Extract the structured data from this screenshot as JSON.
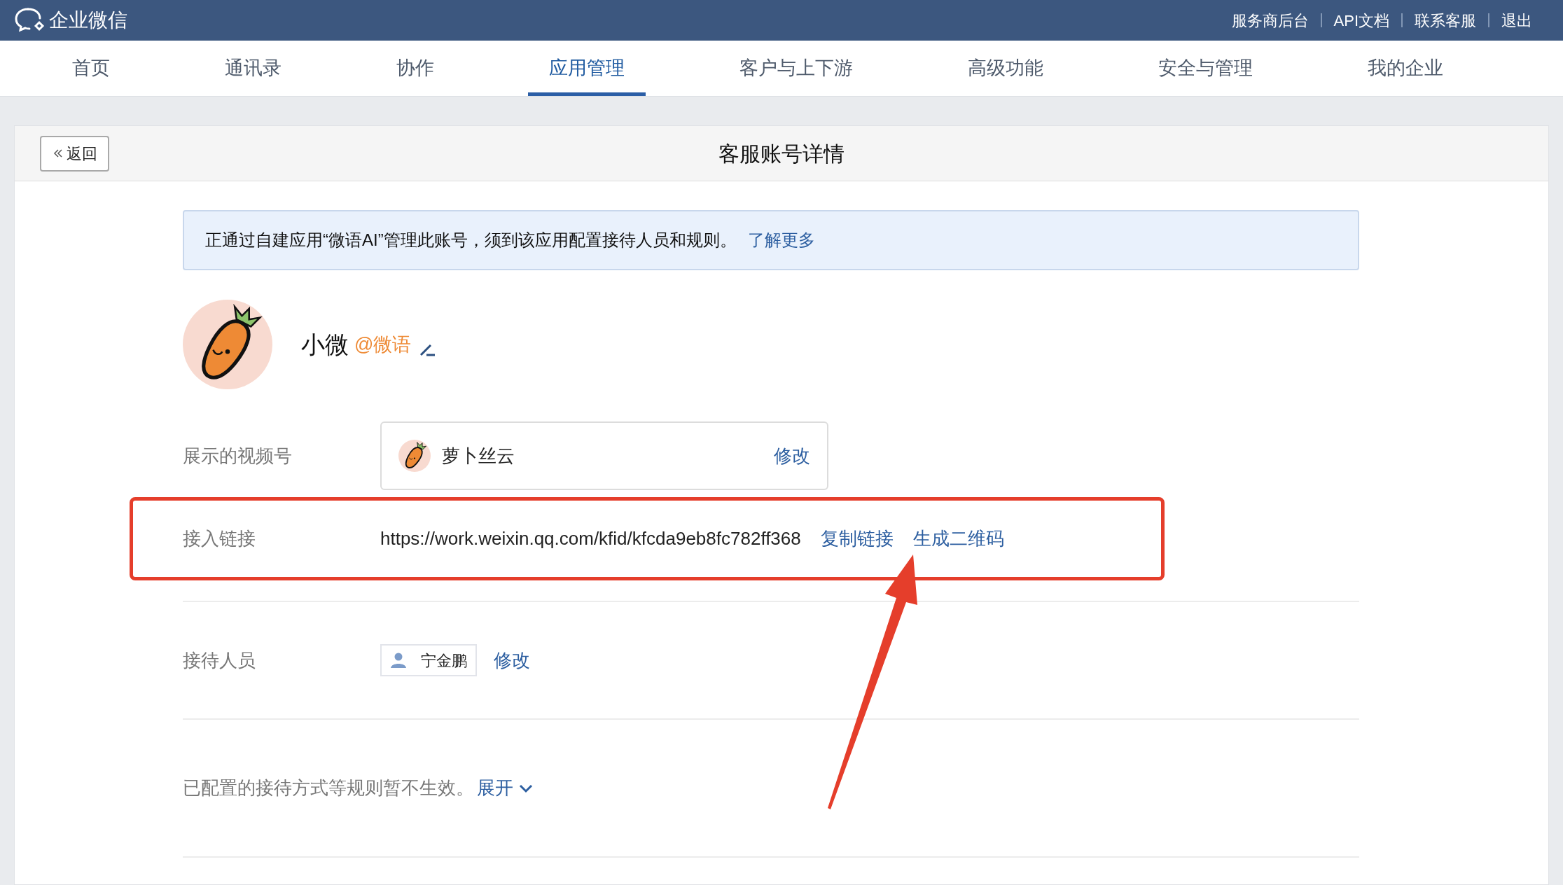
{
  "header": {
    "logo_text": "企业微信",
    "links": [
      "服务商后台",
      "API文档",
      "联系客服",
      "退出"
    ]
  },
  "nav_tabs": [
    {
      "label": "首页",
      "selected": false
    },
    {
      "label": "通讯录",
      "selected": false
    },
    {
      "label": "协作",
      "selected": false
    },
    {
      "label": "应用管理",
      "selected": true
    },
    {
      "label": "客户与上下游",
      "selected": false
    },
    {
      "label": "高级功能",
      "selected": false
    },
    {
      "label": "安全与管理",
      "selected": false
    },
    {
      "label": "我的企业",
      "selected": false
    }
  ],
  "page": {
    "back_button": "返回",
    "title": "客服账号详情"
  },
  "notice": {
    "text": "正通过自建应用“微语AI”管理此账号，须到该应用配置接待人员和规则。",
    "link": "了解更多"
  },
  "profile": {
    "name": "小微",
    "handle": "@微语"
  },
  "fields": [
    {
      "kind": "channel",
      "label": "展示的视频号",
      "value": "萝卜丝云",
      "actions": [
        "修改"
      ],
      "highlighted": false
    },
    {
      "kind": "link",
      "label": "接入链接",
      "value": "https://work.weixin.qq.com/kfid/kfcda9eb8fc782ff368",
      "actions": [
        "复制链接",
        "生成二维码"
      ],
      "highlighted": true
    },
    {
      "kind": "person",
      "label": "接待人员",
      "value": "宁金鹏",
      "actions": [
        "修改"
      ],
      "highlighted": false
    }
  ],
  "rules_note": {
    "text": "已配置的接待方式等规则暂不生效。",
    "toggle": "展开",
    "expanded": false
  }
}
